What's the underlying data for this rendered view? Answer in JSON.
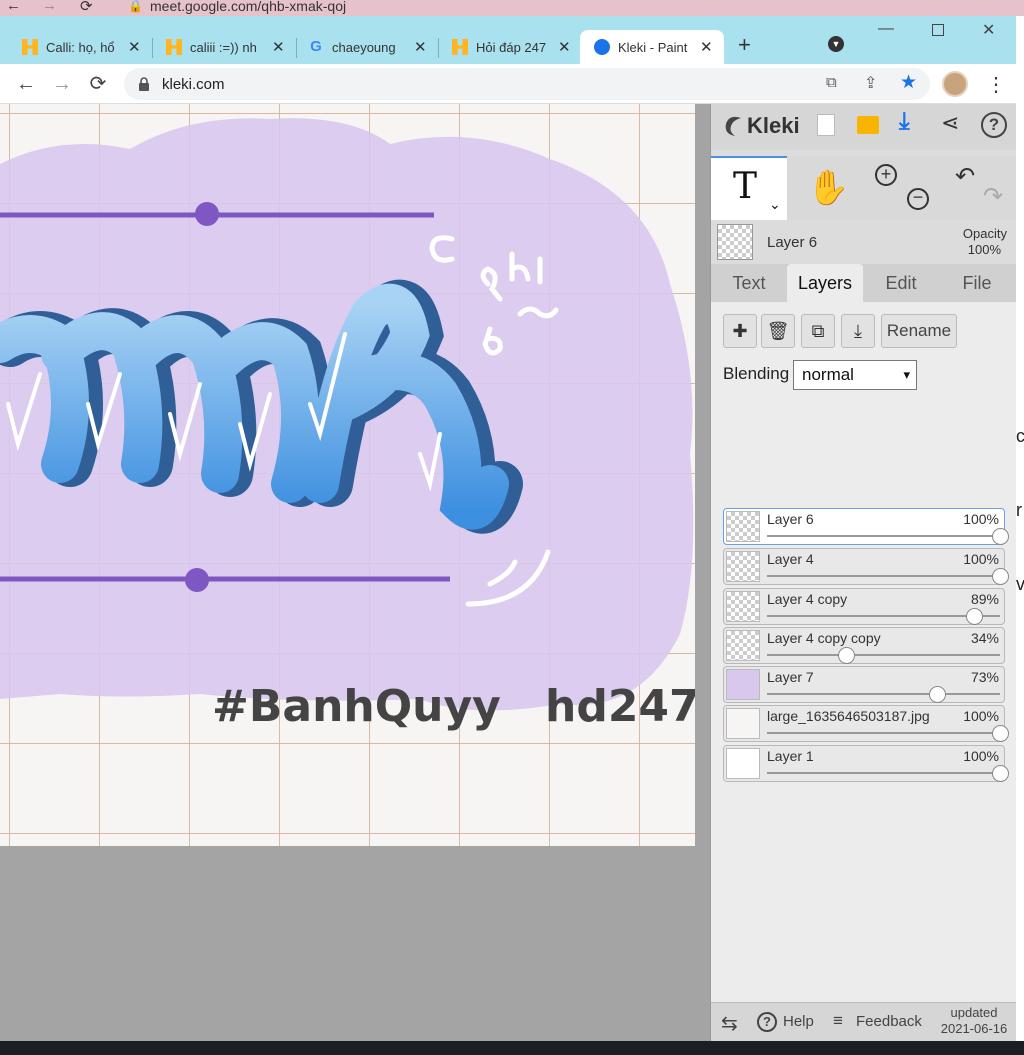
{
  "meet_bar": {
    "url": "meet.google.com/qhb-xmak-qoj"
  },
  "tabs": [
    {
      "title": "Calli: họ, hổ",
      "icon": "hoidap-h-icon"
    },
    {
      "title": "caliii :=)) nh",
      "icon": "hoidap-h-icon"
    },
    {
      "title": "chaeyoung",
      "icon": "google-g-icon"
    },
    {
      "title": "Hỏi đáp 247",
      "icon": "hoidap-h-icon"
    },
    {
      "title": "Kleki - Paint",
      "icon": "kleki-icon",
      "active": true
    }
  ],
  "address_bar": {
    "url": "kleki.com"
  },
  "canvas": {
    "tag_left": "#BanhQuyy",
    "tag_right": "hd247",
    "doodle_text": "c a hi b ~"
  },
  "kleki": {
    "logo": "Kleki",
    "current_layer": {
      "name": "Layer 6",
      "opacity_label": "Opacity",
      "opacity": "100%"
    },
    "tabs": [
      "Text",
      "Layers",
      "Edit",
      "File"
    ],
    "active_tab": "Layers",
    "rename_label": "Rename",
    "blending_label": "Blending",
    "blending_value": "normal",
    "layers": [
      {
        "name": "Layer 6",
        "opacity": "100%",
        "value": 1.0,
        "selected": true
      },
      {
        "name": "Layer 4",
        "opacity": "100%",
        "value": 1.0
      },
      {
        "name": "Layer 4 copy",
        "opacity": "89%",
        "value": 0.89
      },
      {
        "name": "Layer 4 copy copy",
        "opacity": "34%",
        "value": 0.34
      },
      {
        "name": "Layer 7",
        "opacity": "73%",
        "value": 0.73
      },
      {
        "name": "large_1635646503187.jpg",
        "opacity": "100%",
        "value": 1.0
      },
      {
        "name": "Layer 1",
        "opacity": "100%",
        "value": 1.0
      }
    ],
    "footer": {
      "help": "Help",
      "feedback": "Feedback",
      "updated_label": "updated",
      "updated_date": "2021-06-16"
    }
  },
  "bg_sliver_letters": [
    "c",
    "r",
    "v"
  ]
}
